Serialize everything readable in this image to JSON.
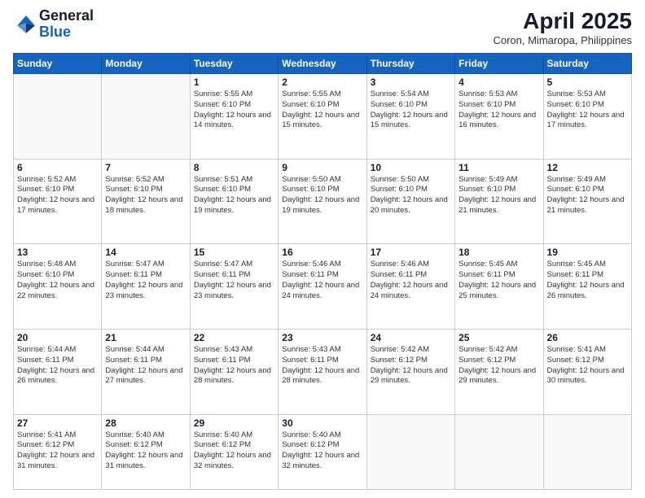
{
  "header": {
    "logo_general": "General",
    "logo_blue": "Blue",
    "month_year": "April 2025",
    "location": "Coron, Mimaropa, Philippines"
  },
  "days_of_week": [
    "Sunday",
    "Monday",
    "Tuesday",
    "Wednesday",
    "Thursday",
    "Friday",
    "Saturday"
  ],
  "weeks": [
    [
      {
        "day": "",
        "info": ""
      },
      {
        "day": "",
        "info": ""
      },
      {
        "day": "1",
        "info": "Sunrise: 5:55 AM\nSunset: 6:10 PM\nDaylight: 12 hours and 14 minutes."
      },
      {
        "day": "2",
        "info": "Sunrise: 5:55 AM\nSunset: 6:10 PM\nDaylight: 12 hours and 15 minutes."
      },
      {
        "day": "3",
        "info": "Sunrise: 5:54 AM\nSunset: 6:10 PM\nDaylight: 12 hours and 15 minutes."
      },
      {
        "day": "4",
        "info": "Sunrise: 5:53 AM\nSunset: 6:10 PM\nDaylight: 12 hours and 16 minutes."
      },
      {
        "day": "5",
        "info": "Sunrise: 5:53 AM\nSunset: 6:10 PM\nDaylight: 12 hours and 17 minutes."
      }
    ],
    [
      {
        "day": "6",
        "info": "Sunrise: 5:52 AM\nSunset: 6:10 PM\nDaylight: 12 hours and 17 minutes."
      },
      {
        "day": "7",
        "info": "Sunrise: 5:52 AM\nSunset: 6:10 PM\nDaylight: 12 hours and 18 minutes."
      },
      {
        "day": "8",
        "info": "Sunrise: 5:51 AM\nSunset: 6:10 PM\nDaylight: 12 hours and 19 minutes."
      },
      {
        "day": "9",
        "info": "Sunrise: 5:50 AM\nSunset: 6:10 PM\nDaylight: 12 hours and 19 minutes."
      },
      {
        "day": "10",
        "info": "Sunrise: 5:50 AM\nSunset: 6:10 PM\nDaylight: 12 hours and 20 minutes."
      },
      {
        "day": "11",
        "info": "Sunrise: 5:49 AM\nSunset: 6:10 PM\nDaylight: 12 hours and 21 minutes."
      },
      {
        "day": "12",
        "info": "Sunrise: 5:49 AM\nSunset: 6:10 PM\nDaylight: 12 hours and 21 minutes."
      }
    ],
    [
      {
        "day": "13",
        "info": "Sunrise: 5:48 AM\nSunset: 6:10 PM\nDaylight: 12 hours and 22 minutes."
      },
      {
        "day": "14",
        "info": "Sunrise: 5:47 AM\nSunset: 6:11 PM\nDaylight: 12 hours and 23 minutes."
      },
      {
        "day": "15",
        "info": "Sunrise: 5:47 AM\nSunset: 6:11 PM\nDaylight: 12 hours and 23 minutes."
      },
      {
        "day": "16",
        "info": "Sunrise: 5:46 AM\nSunset: 6:11 PM\nDaylight: 12 hours and 24 minutes."
      },
      {
        "day": "17",
        "info": "Sunrise: 5:46 AM\nSunset: 6:11 PM\nDaylight: 12 hours and 24 minutes."
      },
      {
        "day": "18",
        "info": "Sunrise: 5:45 AM\nSunset: 6:11 PM\nDaylight: 12 hours and 25 minutes."
      },
      {
        "day": "19",
        "info": "Sunrise: 5:45 AM\nSunset: 6:11 PM\nDaylight: 12 hours and 26 minutes."
      }
    ],
    [
      {
        "day": "20",
        "info": "Sunrise: 5:44 AM\nSunset: 6:11 PM\nDaylight: 12 hours and 26 minutes."
      },
      {
        "day": "21",
        "info": "Sunrise: 5:44 AM\nSunset: 6:11 PM\nDaylight: 12 hours and 27 minutes."
      },
      {
        "day": "22",
        "info": "Sunrise: 5:43 AM\nSunset: 6:11 PM\nDaylight: 12 hours and 28 minutes."
      },
      {
        "day": "23",
        "info": "Sunrise: 5:43 AM\nSunset: 6:11 PM\nDaylight: 12 hours and 28 minutes."
      },
      {
        "day": "24",
        "info": "Sunrise: 5:42 AM\nSunset: 6:12 PM\nDaylight: 12 hours and 29 minutes."
      },
      {
        "day": "25",
        "info": "Sunrise: 5:42 AM\nSunset: 6:12 PM\nDaylight: 12 hours and 29 minutes."
      },
      {
        "day": "26",
        "info": "Sunrise: 5:41 AM\nSunset: 6:12 PM\nDaylight: 12 hours and 30 minutes."
      }
    ],
    [
      {
        "day": "27",
        "info": "Sunrise: 5:41 AM\nSunset: 6:12 PM\nDaylight: 12 hours and 31 minutes."
      },
      {
        "day": "28",
        "info": "Sunrise: 5:40 AM\nSunset: 6:12 PM\nDaylight: 12 hours and 31 minutes."
      },
      {
        "day": "29",
        "info": "Sunrise: 5:40 AM\nSunset: 6:12 PM\nDaylight: 12 hours and 32 minutes."
      },
      {
        "day": "30",
        "info": "Sunrise: 5:40 AM\nSunset: 6:12 PM\nDaylight: 12 hours and 32 minutes."
      },
      {
        "day": "",
        "info": ""
      },
      {
        "day": "",
        "info": ""
      },
      {
        "day": "",
        "info": ""
      }
    ]
  ]
}
